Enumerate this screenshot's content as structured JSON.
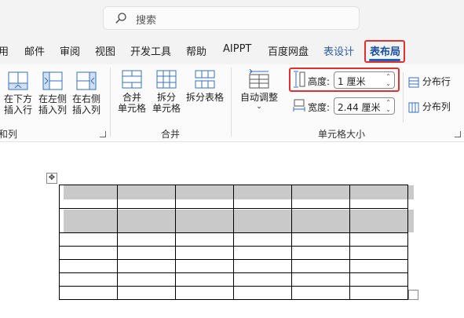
{
  "search": {
    "placeholder": "搜索",
    "icon": "search-icon"
  },
  "tabs": [
    {
      "label": "用",
      "style": "normal"
    },
    {
      "label": "邮件",
      "style": "normal"
    },
    {
      "label": "审阅",
      "style": "normal"
    },
    {
      "label": "视图",
      "style": "normal"
    },
    {
      "label": "开发工具",
      "style": "normal"
    },
    {
      "label": "帮助",
      "style": "normal"
    },
    {
      "label": "AIPPT",
      "style": "normal"
    },
    {
      "label": "百度网盘",
      "style": "normal"
    },
    {
      "label": "表设计",
      "style": "blue"
    },
    {
      "label": "表布局",
      "style": "active"
    }
  ],
  "ribbon": {
    "insert_group": {
      "label": "和列",
      "buttons": [
        {
          "line1": "在下方",
          "line2": "插入行",
          "icon": "insert-row-below-icon"
        },
        {
          "line1": "在左侧",
          "line2": "插入列",
          "icon": "insert-column-left-icon"
        },
        {
          "line1": "在右侧",
          "line2": "插入列",
          "icon": "insert-column-right-icon"
        }
      ]
    },
    "merge_group": {
      "label": "合并",
      "buttons": [
        {
          "line1": "合并",
          "line2": "单元格",
          "icon": "merge-cells-icon"
        },
        {
          "line1": "拆分",
          "line2": "单元格",
          "icon": "split-cells-icon"
        },
        {
          "line1": "拆分表格",
          "line2": "",
          "icon": "split-table-icon"
        }
      ]
    },
    "cell_size_group": {
      "label": "单元格大小",
      "autofit_label": "自动调整",
      "height_label": "高度:",
      "height_value": "1 厘米",
      "width_label": "宽度:",
      "width_value": "2.44 厘米",
      "distribute_rows": "分布行",
      "distribute_cols": "分布列"
    }
  },
  "colors": {
    "accent": "#1b5fc0",
    "highlight_border": "#e03030",
    "active_tab": "#1b4f9c",
    "contextual_tab": "#2a5ea8",
    "row_shading": "#c9c9c9"
  },
  "document": {
    "table": {
      "rows": 7,
      "columns": 6,
      "shaded_rows": [
        0,
        1
      ]
    }
  }
}
